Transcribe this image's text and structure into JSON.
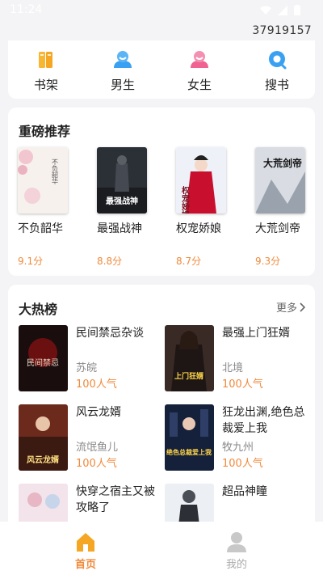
{
  "status_bar": {
    "time": "11:24"
  },
  "user_id": "37919157",
  "nav": [
    {
      "label": "书架",
      "icon": "bookshelf-icon",
      "color": "#f5a623"
    },
    {
      "label": "男生",
      "icon": "male-icon",
      "color": "#3aa1f2"
    },
    {
      "label": "女生",
      "icon": "female-icon",
      "color": "#f06292"
    },
    {
      "label": "搜书",
      "icon": "search-icon",
      "color": "#3aa1f2"
    }
  ],
  "recommend": {
    "title": "重磅推荐",
    "books": [
      {
        "title": "不负韶华",
        "score": "9.1分",
        "cover_text": "不负韶华"
      },
      {
        "title": "最强战神",
        "score": "8.8分",
        "cover_text": "最强战神"
      },
      {
        "title": "权宠娇娘",
        "score": "8.7分",
        "cover_text": "权宠娇娘"
      },
      {
        "title": "大荒剑帝",
        "score": "9.3分",
        "cover_text": "大荒剑帝"
      }
    ]
  },
  "hot": {
    "title": "大热榜",
    "more_label": "更多",
    "items": [
      {
        "title": "民间禁忌杂谈",
        "author": "苏皖",
        "popularity": "100人气",
        "cover_text": "民间禁忌"
      },
      {
        "title": "最强上门狂婿",
        "author": "北境",
        "popularity": "100人气",
        "cover_text": "上门狂婿"
      },
      {
        "title": "风云龙婿",
        "author": "流氓鱼儿",
        "popularity": "100人气",
        "cover_text": "风云龙婿"
      },
      {
        "title": "狂龙出渊,绝色总裁爱上我",
        "author": "牧九州",
        "popularity": "100人气",
        "cover_text": "绝色总裁爱上我"
      },
      {
        "title": "快穿之宿主又被攻略了",
        "author": "",
        "popularity": "",
        "cover_text": ""
      },
      {
        "title": "超品神瞳",
        "author": "",
        "popularity": "",
        "cover_text": ""
      }
    ]
  },
  "tabs": [
    {
      "label": "首页",
      "active": true
    },
    {
      "label": "我的",
      "active": false
    }
  ],
  "colors": {
    "accent": "#f08a3c",
    "background": "#f4f4f6"
  }
}
